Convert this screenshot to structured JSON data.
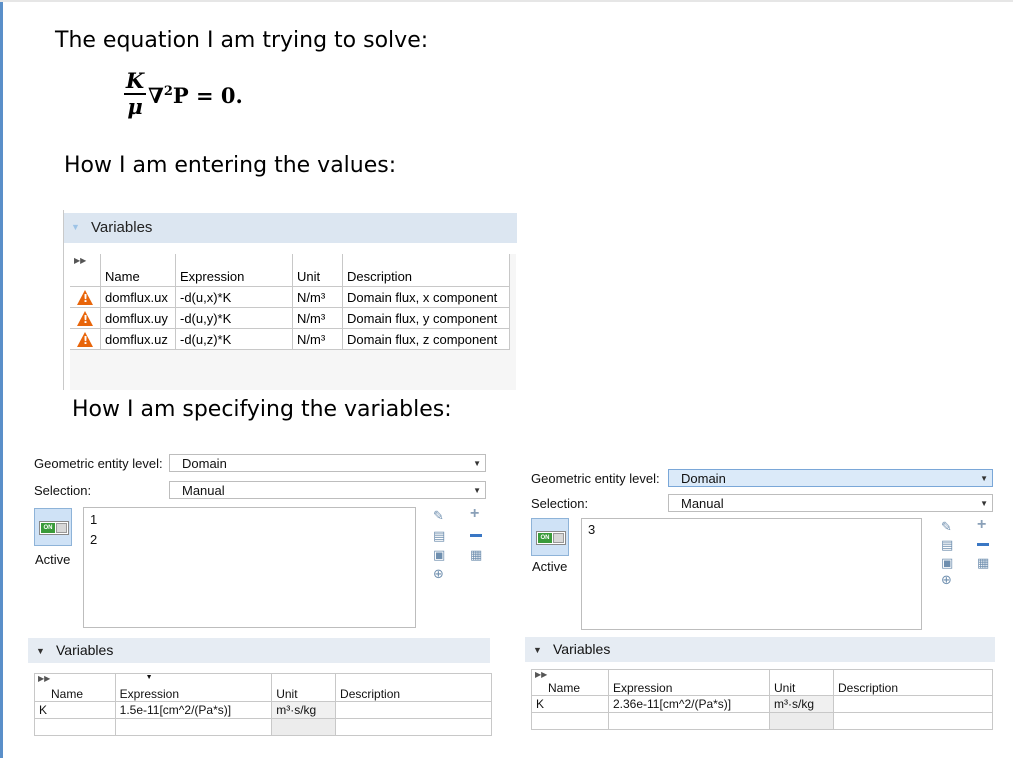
{
  "headings": {
    "equation_label": "The equation I am trying to solve:",
    "entering_label": "How I am entering the values:",
    "specifying_label": "How I am specifying the variables:"
  },
  "equation": {
    "num": "K",
    "den": "μ",
    "rest_pre": "∇",
    "rest_sup": "2",
    "rest_post": "P = 0."
  },
  "panel1": {
    "header": "Variables",
    "columns": [
      "Name",
      "Expression",
      "Unit",
      "Description"
    ],
    "rows": [
      {
        "name": "domflux.ux",
        "expression": "-d(u,x)*K",
        "unit": "N/m³",
        "description": "Domain flux, x component"
      },
      {
        "name": "domflux.uy",
        "expression": "-d(u,y)*K",
        "unit": "N/m³",
        "description": "Domain flux, y component"
      },
      {
        "name": "domflux.uz",
        "expression": "-d(u,z)*K",
        "unit": "N/m³",
        "description": "Domain flux, z component"
      }
    ]
  },
  "left_settings": {
    "geo_label": "Geometric entity level:",
    "geo_value": "Domain",
    "sel_label": "Selection:",
    "sel_value": "Manual",
    "items": [
      "1",
      "2"
    ],
    "toggle_text": "ON",
    "active_label": "Active",
    "vars_header": "Variables",
    "columns": [
      "Name",
      "Expression",
      "Unit",
      "Description"
    ],
    "row": {
      "name": "K",
      "expression": "1.5e-11[cm^2/(Pa*s)]",
      "unit": "m³·s/kg",
      "description": ""
    }
  },
  "right_settings": {
    "geo_label": "Geometric entity level:",
    "geo_value": "Domain",
    "sel_label": "Selection:",
    "sel_value": "Manual",
    "items": [
      "3"
    ],
    "toggle_text": "ON",
    "active_label": "Active",
    "vars_header": "Variables",
    "columns": [
      "Name",
      "Expression",
      "Unit",
      "Description"
    ],
    "row": {
      "name": "K",
      "expression": "2.36e-11[cm^2/(Pa*s)]",
      "unit": "m³·s/kg",
      "description": ""
    }
  },
  "colors": {
    "accent": "#dce6f1",
    "warning": "#e8650a",
    "left_bar": "#5a8fc9"
  },
  "icons": [
    "warning-icon",
    "fast-forward-icon",
    "collapse-triangle-icon",
    "dropdown-arrow-icon",
    "paste-icon",
    "copy-icon",
    "clear-icon",
    "zoom-to-selection-icon",
    "plus-icon",
    "minus-icon",
    "toggle-on-icon"
  ]
}
